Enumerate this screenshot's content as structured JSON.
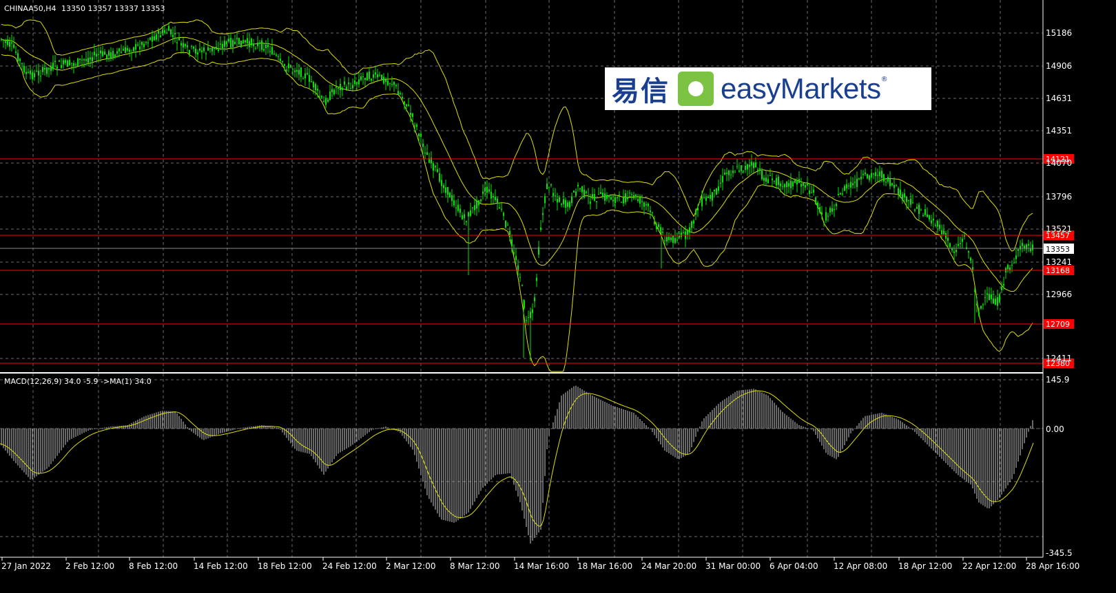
{
  "header": {
    "symbol": "CHINAA50,H4",
    "ohlc": "13350 13357 13337 13353"
  },
  "logo": {
    "cn_text": "易信",
    "en_text": "easyMarkets",
    "reg": "®"
  },
  "price_axis": {
    "ticks": [
      "15186",
      "14906",
      "14631",
      "14351",
      "14070",
      "13796",
      "13521",
      "13241",
      "12966",
      "12411"
    ],
    "current": "13353",
    "levels": [
      "14121",
      "13457",
      "13168",
      "12709",
      "12380"
    ]
  },
  "macd": {
    "label": "MACD(12,26,9) 34.0 -5.9  ->MA(1) 34.0",
    "ticks": [
      "145.9",
      "0.00",
      "-345.5"
    ]
  },
  "time_axis": {
    "labels": [
      "27 Jan 2022",
      "2 Feb 12:00",
      "8 Feb 12:00",
      "14 Feb 12:00",
      "18 Feb 12:00",
      "24 Feb 12:00",
      "2 Mar 12:00",
      "8 Mar 12:00",
      "14 Mar 16:00",
      "18 Mar 16:00",
      "24 Mar 20:00",
      "31 Mar 00:00",
      "6 Apr 04:00",
      "12 Apr 08:00",
      "18 Apr 12:00",
      "22 Apr 12:00",
      "28 Apr 16:00"
    ]
  },
  "colors": {
    "background": "#000000",
    "grid": "#6a6a6a",
    "candles": "#00e600",
    "bands": "#e0e000",
    "levels": "#ff0000",
    "level_label_bg": "#ff0000",
    "macd_hist": "#d0d0d0",
    "macd_signal": "#e0e000",
    "separator": "#ffffff"
  }
}
